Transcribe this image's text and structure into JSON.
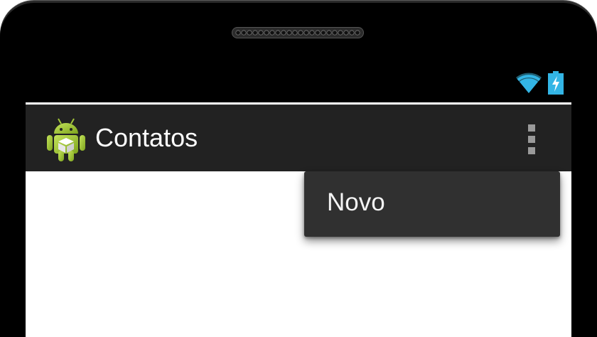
{
  "action_bar": {
    "title": "Contatos",
    "app_icon": "android-app-icon",
    "overflow_icon": "overflow-menu-icon"
  },
  "status_bar": {
    "wifi_icon": "wifi-icon",
    "battery_icon": "battery-charging-icon",
    "accent_color": "#33b5e5"
  },
  "overflow_menu": {
    "items": [
      {
        "label": "Novo"
      }
    ]
  },
  "colors": {
    "action_bar_bg": "#222222",
    "menu_bg": "#303030",
    "android_green": "#a4c639",
    "screen_bg": "#ffffff"
  }
}
